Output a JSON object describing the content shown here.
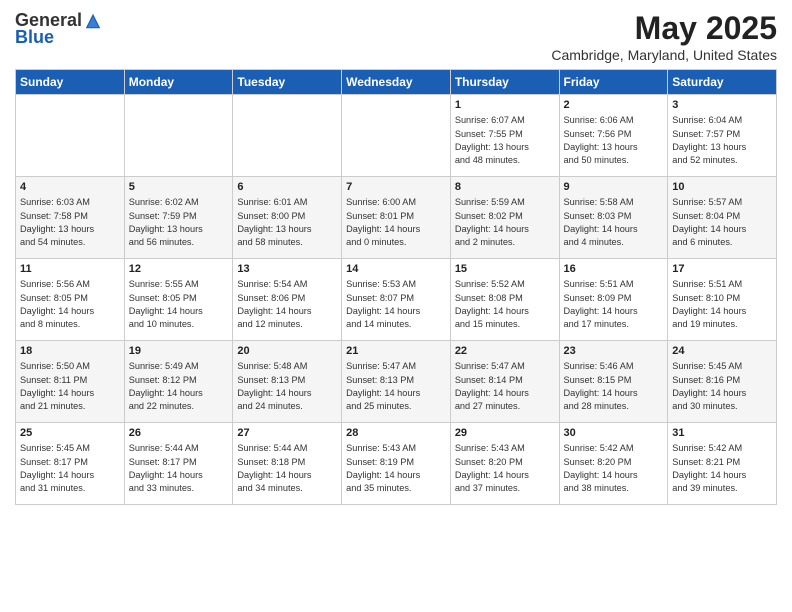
{
  "logo": {
    "general": "General",
    "blue": "Blue"
  },
  "title": "May 2025",
  "subtitle": "Cambridge, Maryland, United States",
  "days_of_week": [
    "Sunday",
    "Monday",
    "Tuesday",
    "Wednesday",
    "Thursday",
    "Friday",
    "Saturday"
  ],
  "weeks": [
    [
      {
        "day": "",
        "info": ""
      },
      {
        "day": "",
        "info": ""
      },
      {
        "day": "",
        "info": ""
      },
      {
        "day": "",
        "info": ""
      },
      {
        "day": "1",
        "info": "Sunrise: 6:07 AM\nSunset: 7:55 PM\nDaylight: 13 hours\nand 48 minutes."
      },
      {
        "day": "2",
        "info": "Sunrise: 6:06 AM\nSunset: 7:56 PM\nDaylight: 13 hours\nand 50 minutes."
      },
      {
        "day": "3",
        "info": "Sunrise: 6:04 AM\nSunset: 7:57 PM\nDaylight: 13 hours\nand 52 minutes."
      }
    ],
    [
      {
        "day": "4",
        "info": "Sunrise: 6:03 AM\nSunset: 7:58 PM\nDaylight: 13 hours\nand 54 minutes."
      },
      {
        "day": "5",
        "info": "Sunrise: 6:02 AM\nSunset: 7:59 PM\nDaylight: 13 hours\nand 56 minutes."
      },
      {
        "day": "6",
        "info": "Sunrise: 6:01 AM\nSunset: 8:00 PM\nDaylight: 13 hours\nand 58 minutes."
      },
      {
        "day": "7",
        "info": "Sunrise: 6:00 AM\nSunset: 8:01 PM\nDaylight: 14 hours\nand 0 minutes."
      },
      {
        "day": "8",
        "info": "Sunrise: 5:59 AM\nSunset: 8:02 PM\nDaylight: 14 hours\nand 2 minutes."
      },
      {
        "day": "9",
        "info": "Sunrise: 5:58 AM\nSunset: 8:03 PM\nDaylight: 14 hours\nand 4 minutes."
      },
      {
        "day": "10",
        "info": "Sunrise: 5:57 AM\nSunset: 8:04 PM\nDaylight: 14 hours\nand 6 minutes."
      }
    ],
    [
      {
        "day": "11",
        "info": "Sunrise: 5:56 AM\nSunset: 8:05 PM\nDaylight: 14 hours\nand 8 minutes."
      },
      {
        "day": "12",
        "info": "Sunrise: 5:55 AM\nSunset: 8:05 PM\nDaylight: 14 hours\nand 10 minutes."
      },
      {
        "day": "13",
        "info": "Sunrise: 5:54 AM\nSunset: 8:06 PM\nDaylight: 14 hours\nand 12 minutes."
      },
      {
        "day": "14",
        "info": "Sunrise: 5:53 AM\nSunset: 8:07 PM\nDaylight: 14 hours\nand 14 minutes."
      },
      {
        "day": "15",
        "info": "Sunrise: 5:52 AM\nSunset: 8:08 PM\nDaylight: 14 hours\nand 15 minutes."
      },
      {
        "day": "16",
        "info": "Sunrise: 5:51 AM\nSunset: 8:09 PM\nDaylight: 14 hours\nand 17 minutes."
      },
      {
        "day": "17",
        "info": "Sunrise: 5:51 AM\nSunset: 8:10 PM\nDaylight: 14 hours\nand 19 minutes."
      }
    ],
    [
      {
        "day": "18",
        "info": "Sunrise: 5:50 AM\nSunset: 8:11 PM\nDaylight: 14 hours\nand 21 minutes."
      },
      {
        "day": "19",
        "info": "Sunrise: 5:49 AM\nSunset: 8:12 PM\nDaylight: 14 hours\nand 22 minutes."
      },
      {
        "day": "20",
        "info": "Sunrise: 5:48 AM\nSunset: 8:13 PM\nDaylight: 14 hours\nand 24 minutes."
      },
      {
        "day": "21",
        "info": "Sunrise: 5:47 AM\nSunset: 8:13 PM\nDaylight: 14 hours\nand 25 minutes."
      },
      {
        "day": "22",
        "info": "Sunrise: 5:47 AM\nSunset: 8:14 PM\nDaylight: 14 hours\nand 27 minutes."
      },
      {
        "day": "23",
        "info": "Sunrise: 5:46 AM\nSunset: 8:15 PM\nDaylight: 14 hours\nand 28 minutes."
      },
      {
        "day": "24",
        "info": "Sunrise: 5:45 AM\nSunset: 8:16 PM\nDaylight: 14 hours\nand 30 minutes."
      }
    ],
    [
      {
        "day": "25",
        "info": "Sunrise: 5:45 AM\nSunset: 8:17 PM\nDaylight: 14 hours\nand 31 minutes."
      },
      {
        "day": "26",
        "info": "Sunrise: 5:44 AM\nSunset: 8:17 PM\nDaylight: 14 hours\nand 33 minutes."
      },
      {
        "day": "27",
        "info": "Sunrise: 5:44 AM\nSunset: 8:18 PM\nDaylight: 14 hours\nand 34 minutes."
      },
      {
        "day": "28",
        "info": "Sunrise: 5:43 AM\nSunset: 8:19 PM\nDaylight: 14 hours\nand 35 minutes."
      },
      {
        "day": "29",
        "info": "Sunrise: 5:43 AM\nSunset: 8:20 PM\nDaylight: 14 hours\nand 37 minutes."
      },
      {
        "day": "30",
        "info": "Sunrise: 5:42 AM\nSunset: 8:20 PM\nDaylight: 14 hours\nand 38 minutes."
      },
      {
        "day": "31",
        "info": "Sunrise: 5:42 AM\nSunset: 8:21 PM\nDaylight: 14 hours\nand 39 minutes."
      }
    ]
  ]
}
